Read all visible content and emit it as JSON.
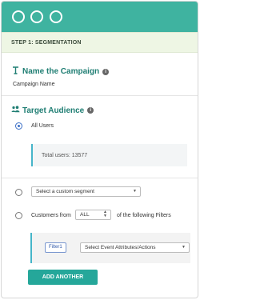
{
  "step": {
    "label": "STEP 1: SEGMENTATION"
  },
  "campaign": {
    "title": "Name the Campaign",
    "field_label": "Campaign Name"
  },
  "audience": {
    "title": "Target Audience",
    "options": {
      "all_users": "All Users",
      "total_users": "Total users: 13577",
      "custom_segment_placeholder": "Select a custom segment",
      "customers_from_prefix": "Customers from",
      "customers_scope": "ALL",
      "customers_suffix": "of the following Filters"
    },
    "filter": {
      "tag": "Filter1",
      "select_placeholder": "Select Event Attributes/Actions"
    },
    "add_another": "ADD ANOTHER"
  },
  "icons": {
    "window_buttons": [
      "window-circle-icon",
      "window-circle-icon",
      "window-circle-icon"
    ],
    "campaign": "text-cursor-icon",
    "audience": "users-icon",
    "info": "info-icon",
    "dropdown": "caret-down-icon",
    "updown": "caret-updown-icon"
  },
  "colors": {
    "titlebar": "#3fb3a0",
    "step_band": "#eef6e4",
    "section_title": "#1f7e73",
    "radio_selected": "#3b6fc6",
    "button": "#25a79a",
    "accent_border": "#46b5c9"
  }
}
